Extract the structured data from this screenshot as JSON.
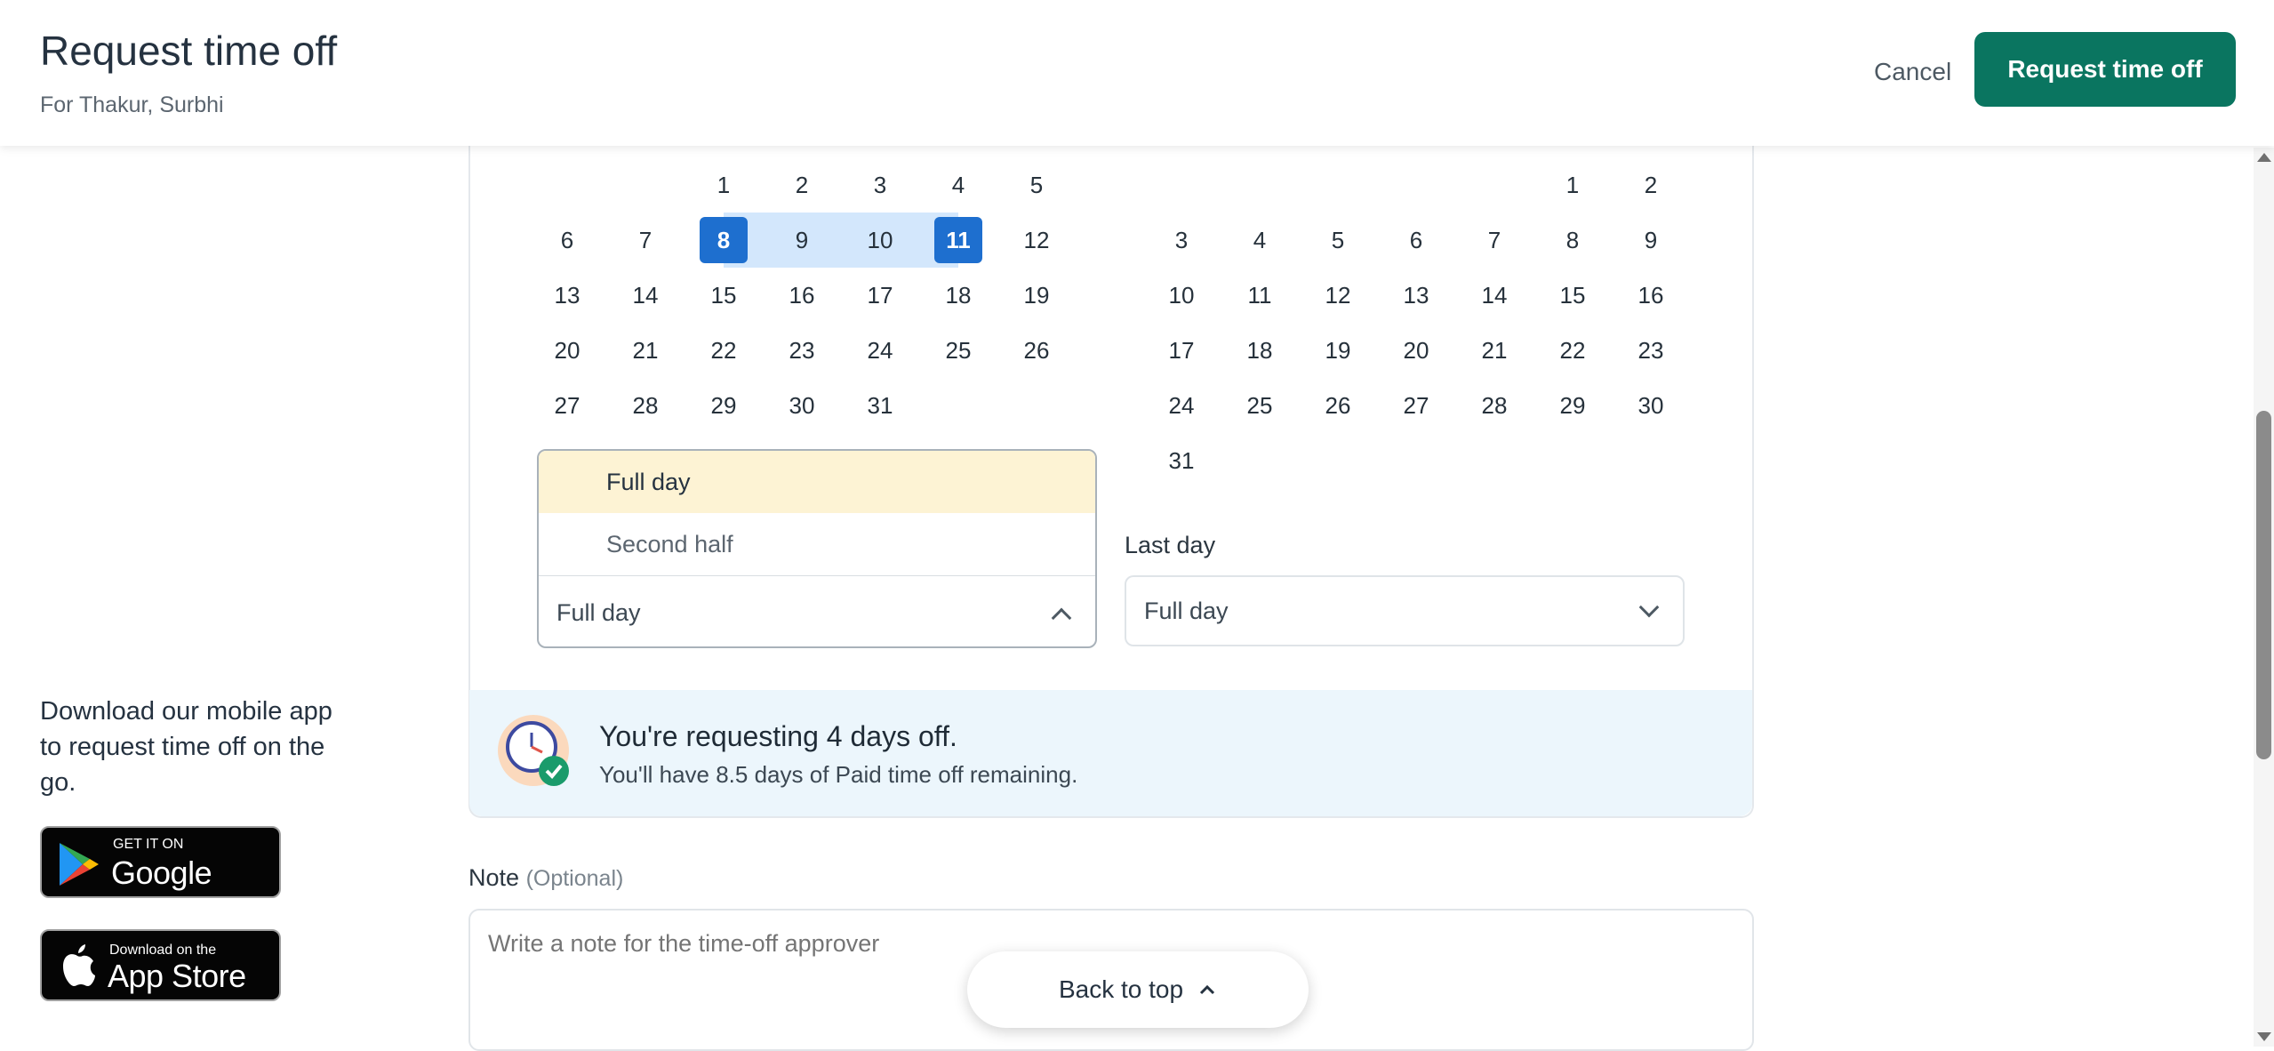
{
  "header": {
    "title": "Request time off",
    "subtitle": "For Thakur, Surbhi",
    "cancel_label": "Cancel",
    "submit_label": "Request time off"
  },
  "calendar_left": {
    "weeks": [
      [
        "",
        "",
        "1",
        "2",
        "3",
        "4",
        "5"
      ],
      [
        "6",
        "7",
        "8",
        "9",
        "10",
        "11",
        "12"
      ],
      [
        "13",
        "14",
        "15",
        "16",
        "17",
        "18",
        "19"
      ],
      [
        "20",
        "21",
        "22",
        "23",
        "24",
        "25",
        "26"
      ],
      [
        "27",
        "28",
        "29",
        "30",
        "31",
        "",
        ""
      ]
    ],
    "selected_start": "8",
    "selected_end": "11",
    "in_range": [
      "9",
      "10"
    ]
  },
  "calendar_right": {
    "weeks": [
      [
        "",
        "",
        "",
        "",
        "",
        "1",
        "2"
      ],
      [
        "3",
        "4",
        "5",
        "6",
        "7",
        "8",
        "9"
      ],
      [
        "10",
        "11",
        "12",
        "13",
        "14",
        "15",
        "16"
      ],
      [
        "17",
        "18",
        "19",
        "20",
        "21",
        "22",
        "23"
      ],
      [
        "24",
        "25",
        "26",
        "27",
        "28",
        "29",
        "30"
      ],
      [
        "31",
        "",
        "",
        "",
        "",
        "",
        ""
      ]
    ]
  },
  "first_day_dropdown": {
    "options": [
      "Full day",
      "Second half"
    ],
    "highlighted": "Full day",
    "value": "Full day"
  },
  "last_day": {
    "label": "Last day",
    "value": "Full day"
  },
  "banner": {
    "title": "You're requesting 4 days off.",
    "subtitle": "You'll have 8.5 days of Paid time off remaining."
  },
  "note": {
    "label": "Note",
    "optional": "(Optional)",
    "placeholder": "Write a note for the time-off approver"
  },
  "back_to_top": "Back to top",
  "promo": {
    "text": "Download our mobile app to request time off on the go.",
    "google_small": "GET IT ON",
    "google_big": "Google Play",
    "apple_small": "Download on the",
    "apple_big": "App Store"
  },
  "colors": {
    "primary": "#0a7560",
    "selected_day": "#1e6fcf",
    "range": "#d3e7fc",
    "banner_bg": "#ecf6fc",
    "option_highlight": "#fdf3d4"
  }
}
